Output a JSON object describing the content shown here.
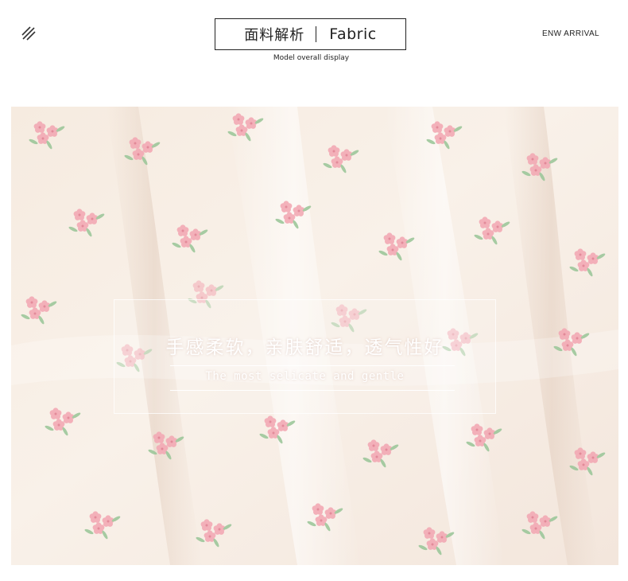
{
  "header": {
    "title_cn": "面料解析",
    "title_en": "Fabric",
    "subtitle": "Model overall display",
    "corner_text": "ENW ARRIVAL",
    "menu_icon": "diagonal-lines-icon"
  },
  "photo": {
    "caption_cn": "手感柔软，亲肤舒适，透气性好",
    "caption_en": "The most selicate and gentle",
    "colors": {
      "fabric_base": "#f7ece1",
      "flower_pink": "#f2a9b4",
      "leaf_green": "#9cc79a",
      "caption_text": "#ffffff"
    }
  }
}
